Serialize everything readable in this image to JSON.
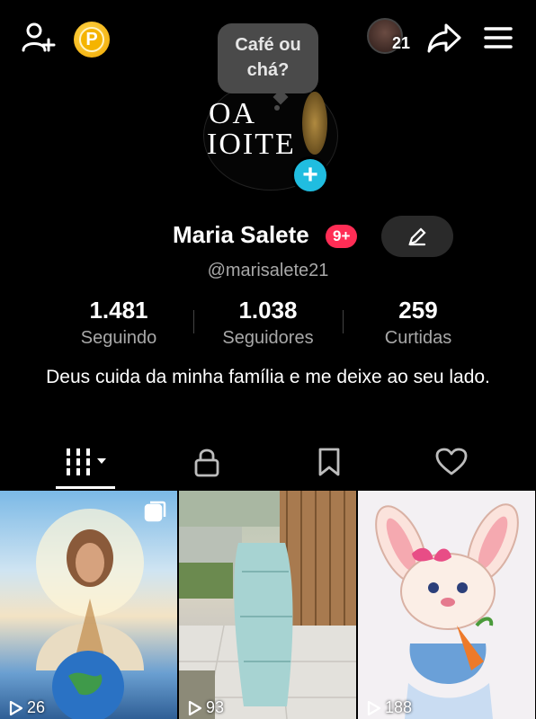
{
  "topbar": {
    "story_count": "21",
    "coin_letter": "P"
  },
  "note": {
    "text": "Café ou chá?"
  },
  "avatar": {
    "line1": "OA",
    "line2": "IOITE"
  },
  "profile": {
    "name": "Maria Salete",
    "badge": "9+",
    "username": "@marisalete21",
    "bio": "Deus cuida da minha família e me deixe ao seu lado."
  },
  "stats": [
    {
      "value": "1.481",
      "label": "Seguindo"
    },
    {
      "value": "1.038",
      "label": "Seguidores"
    },
    {
      "value": "259",
      "label": "Curtidas"
    }
  ],
  "tabs": [
    {
      "icon": "grid-icon"
    },
    {
      "icon": "lock-icon"
    },
    {
      "icon": "bookmark-icon"
    },
    {
      "icon": "heart-icon"
    }
  ],
  "videos": [
    {
      "views": "26"
    },
    {
      "views": "93"
    },
    {
      "views": "188"
    }
  ],
  "colors": {
    "accent_blue": "#20bde0",
    "badge_red": "#ff2d55",
    "coin": "#f5b400",
    "background": "#000000"
  }
}
